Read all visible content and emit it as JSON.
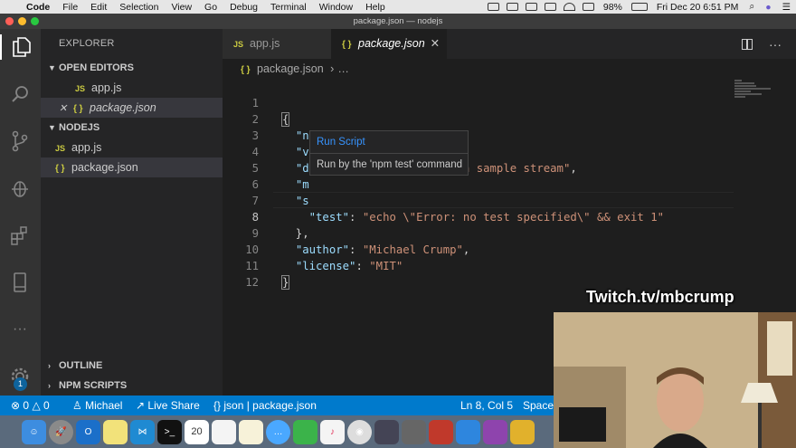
{
  "menubar": {
    "app": "Code",
    "items": [
      "File",
      "Edit",
      "Selection",
      "View",
      "Go",
      "Debug",
      "Terminal",
      "Window",
      "Help"
    ],
    "battery": "98%",
    "clock": "Fri Dec 20  6:51 PM"
  },
  "window": {
    "title": "package.json — nodejs"
  },
  "sidebar": {
    "title": "EXPLORER",
    "open_editors_label": "OPEN EDITORS",
    "open_editors": [
      {
        "name": "app.js",
        "icon": "js-icon"
      },
      {
        "name": "package.json",
        "icon": "json-icon"
      }
    ],
    "project_label": "NODEJS",
    "files": [
      {
        "name": "app.js",
        "icon": "js-icon"
      },
      {
        "name": "package.json",
        "icon": "json-icon"
      }
    ],
    "outline_label": "OUTLINE",
    "npm_scripts_label": "NPM SCRIPTS"
  },
  "activity": {
    "settings_badge": "1"
  },
  "tabs": [
    {
      "label": "app.js",
      "icon": "js-icon"
    },
    {
      "label": "package.json",
      "icon": "json-icon"
    }
  ],
  "breadcrumb": {
    "file": "package.json",
    "rest": "…"
  },
  "editor": {
    "line_numbers": [
      "1",
      "2",
      "3",
      "4",
      "5",
      "6",
      "7",
      "8",
      "9",
      "10",
      "11",
      "12"
    ]
  },
  "hover": {
    "link": "Run Script",
    "description": "Run by the 'npm test' command"
  },
  "status": {
    "errors": "0",
    "warnings": "0",
    "user": "Michael",
    "live_share": "Live Share",
    "language": "json |",
    "file": "package.json",
    "position": "Ln 8, Col 5",
    "spaces": "Spaces"
  },
  "overlay": {
    "twitch": "Twitch.tv/mbcrump"
  },
  "dock": {
    "calendar_day": "20"
  },
  "colors": {
    "accent": "#007acc",
    "key": "#9cdcfe",
    "string": "#ce9178",
    "link": "#3794ff"
  }
}
